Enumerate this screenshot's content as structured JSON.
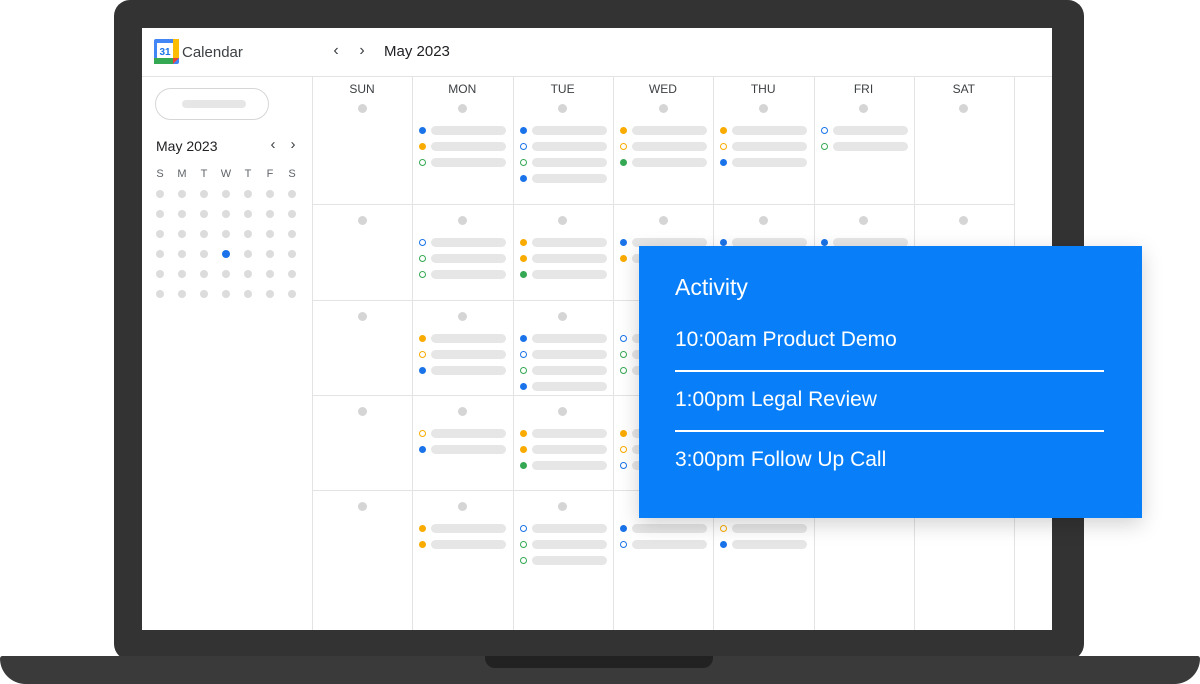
{
  "header": {
    "logo_text": "31",
    "app_name": "Calendar",
    "prev_label": "‹",
    "next_label": "›",
    "month": "May 2023"
  },
  "sidebar": {
    "mini_month": "May 2023",
    "prev_label": "‹",
    "next_label": "›",
    "weekdays": [
      "S",
      "M",
      "T",
      "W",
      "T",
      "F",
      "S"
    ],
    "today": {
      "week": 3,
      "day": 3
    }
  },
  "calendar": {
    "day_headers": [
      "SUN",
      "MON",
      "TUE",
      "WED",
      "THU",
      "FRI",
      "SAT"
    ],
    "events": [
      [
        [],
        [
          [
            "#1a73e8",
            1
          ],
          [
            "#f9ab00",
            1
          ],
          [
            "#34a853",
            0
          ]
        ],
        [
          [
            "#1a73e8",
            1
          ],
          [
            "#1a73e8",
            0
          ],
          [
            "#34a853",
            0
          ],
          [
            "#1a73e8",
            1
          ]
        ],
        [
          [
            "#f9ab00",
            1
          ],
          [
            "#f9ab00",
            0
          ],
          [
            "#34a853",
            1
          ]
        ],
        [
          [
            "#f9ab00",
            1
          ],
          [
            "#f9ab00",
            0
          ],
          [
            "#1a73e8",
            1
          ]
        ],
        [
          [
            "#1a73e8",
            0
          ],
          [
            "#34a853",
            0
          ]
        ],
        []
      ],
      [
        [],
        [
          [
            "#1a73e8",
            0
          ],
          [
            "#34a853",
            0
          ],
          [
            "#34a853",
            0
          ]
        ],
        [
          [
            "#f9ab00",
            1
          ],
          [
            "#f9ab00",
            1
          ],
          [
            "#34a853",
            1
          ]
        ],
        [
          [
            "#1a73e8",
            1
          ],
          [
            "#f9ab00",
            1
          ]
        ],
        [
          [
            "#1a73e8",
            1
          ]
        ],
        [
          [
            "#1a73e8",
            1
          ]
        ],
        []
      ],
      [
        [],
        [
          [
            "#f9ab00",
            1
          ],
          [
            "#f9ab00",
            0
          ],
          [
            "#1a73e8",
            1
          ]
        ],
        [
          [
            "#1a73e8",
            1
          ],
          [
            "#1a73e8",
            0
          ],
          [
            "#34a853",
            0
          ],
          [
            "#1a73e8",
            1
          ]
        ],
        [
          [
            "#1a73e8",
            0
          ],
          [
            "#34a853",
            0
          ],
          [
            "#34a853",
            0
          ]
        ],
        [],
        [],
        []
      ],
      [
        [],
        [
          [
            "#f9ab00",
            0
          ],
          [
            "#1a73e8",
            1
          ]
        ],
        [
          [
            "#f9ab00",
            1
          ],
          [
            "#f9ab00",
            1
          ],
          [
            "#34a853",
            1
          ]
        ],
        [
          [
            "#f9ab00",
            1
          ],
          [
            "#f9ab00",
            0
          ],
          [
            "#1a73e8",
            0
          ]
        ],
        [],
        [],
        []
      ],
      [
        [],
        [
          [
            "#f9ab00",
            1
          ],
          [
            "#f9ab00",
            1
          ]
        ],
        [
          [
            "#1a73e8",
            0
          ],
          [
            "#34a853",
            0
          ],
          [
            "#34a853",
            0
          ]
        ],
        [
          [
            "#1a73e8",
            1
          ],
          [
            "#1a73e8",
            0
          ]
        ],
        [
          [
            "#f9ab00",
            0
          ],
          [
            "#1a73e8",
            1
          ]
        ],
        [],
        []
      ]
    ]
  },
  "activity": {
    "title": "Activity",
    "items": [
      "10:00am Product Demo",
      "1:00pm Legal Review",
      "3:00pm Follow Up Call"
    ]
  }
}
